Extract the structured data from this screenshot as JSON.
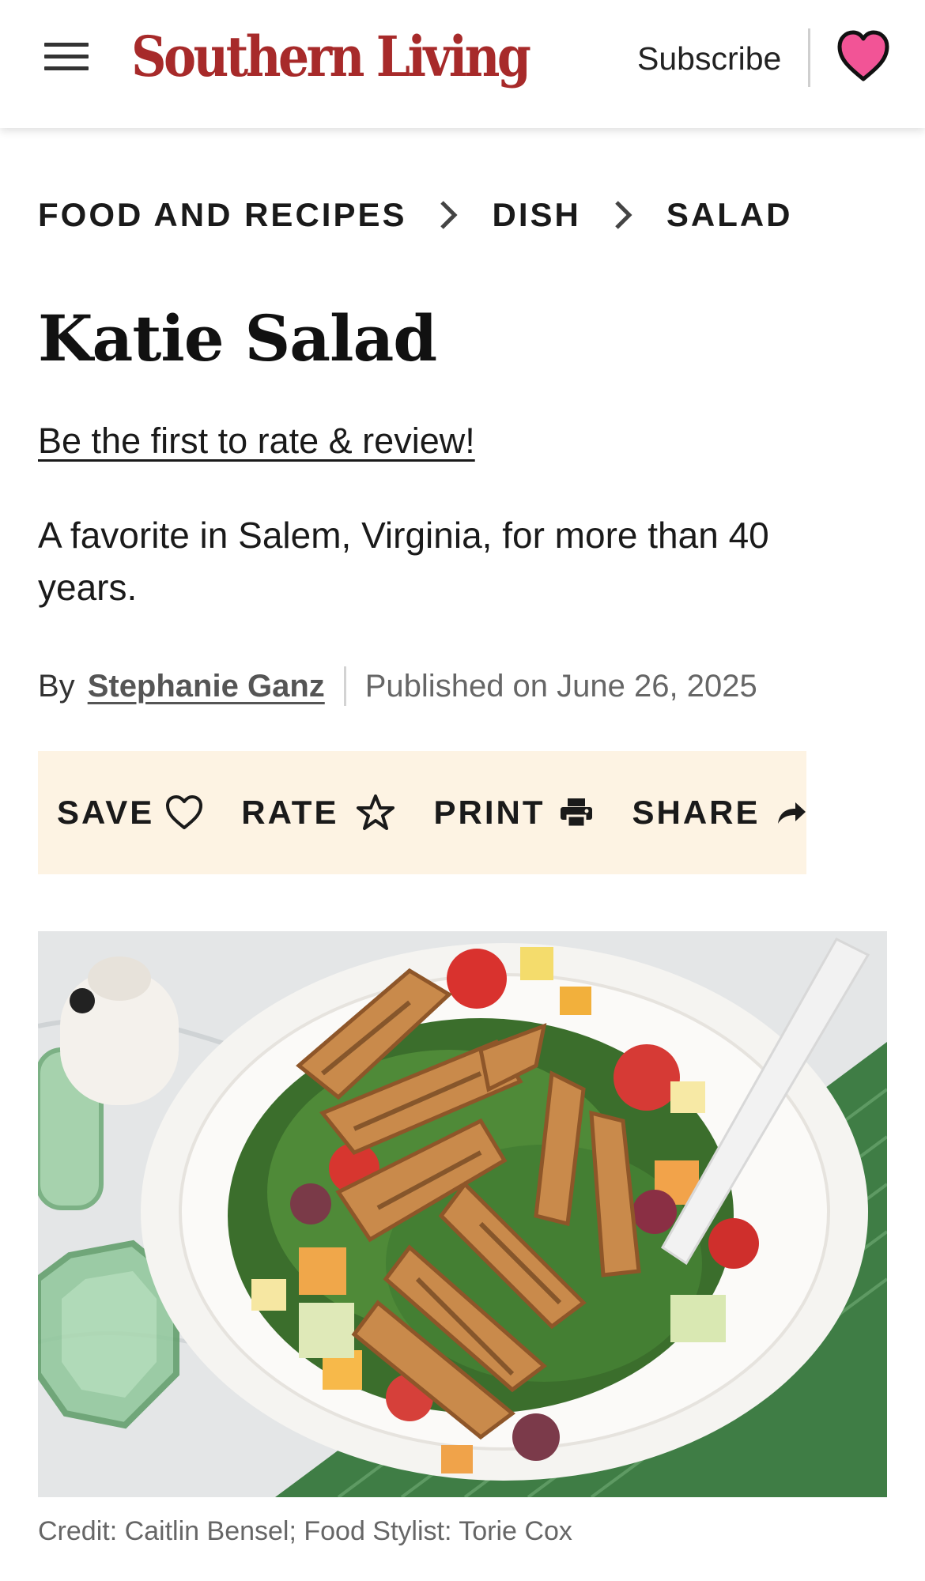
{
  "header": {
    "logo_text": "Southern Living",
    "logo_color": "#a72a2a",
    "subscribe_label": "Subscribe",
    "menu_icon": "hamburger-menu-icon",
    "saved_icon": "heart-icon",
    "heart_color": "#f25496"
  },
  "breadcrumb": [
    {
      "label": "FOOD AND RECIPES"
    },
    {
      "label": "DISH"
    },
    {
      "label": "SALAD"
    }
  ],
  "article": {
    "title": "Katie Salad",
    "rating_prompt": "Be the first to rate & review!",
    "description": "A favorite in Salem, Virginia, for more than 40 years.",
    "byline": {
      "by_label": "By",
      "author": "Stephanie Ganz",
      "published": "Published on June 26, 2025"
    }
  },
  "actions": {
    "background_color": "#fdf3e3",
    "save": "SAVE",
    "rate": "RATE",
    "print": "PRINT",
    "share": "SHARE"
  },
  "hero": {
    "credit": "Credit: Caitlin Bensel; Food Stylist: Torie Cox"
  }
}
